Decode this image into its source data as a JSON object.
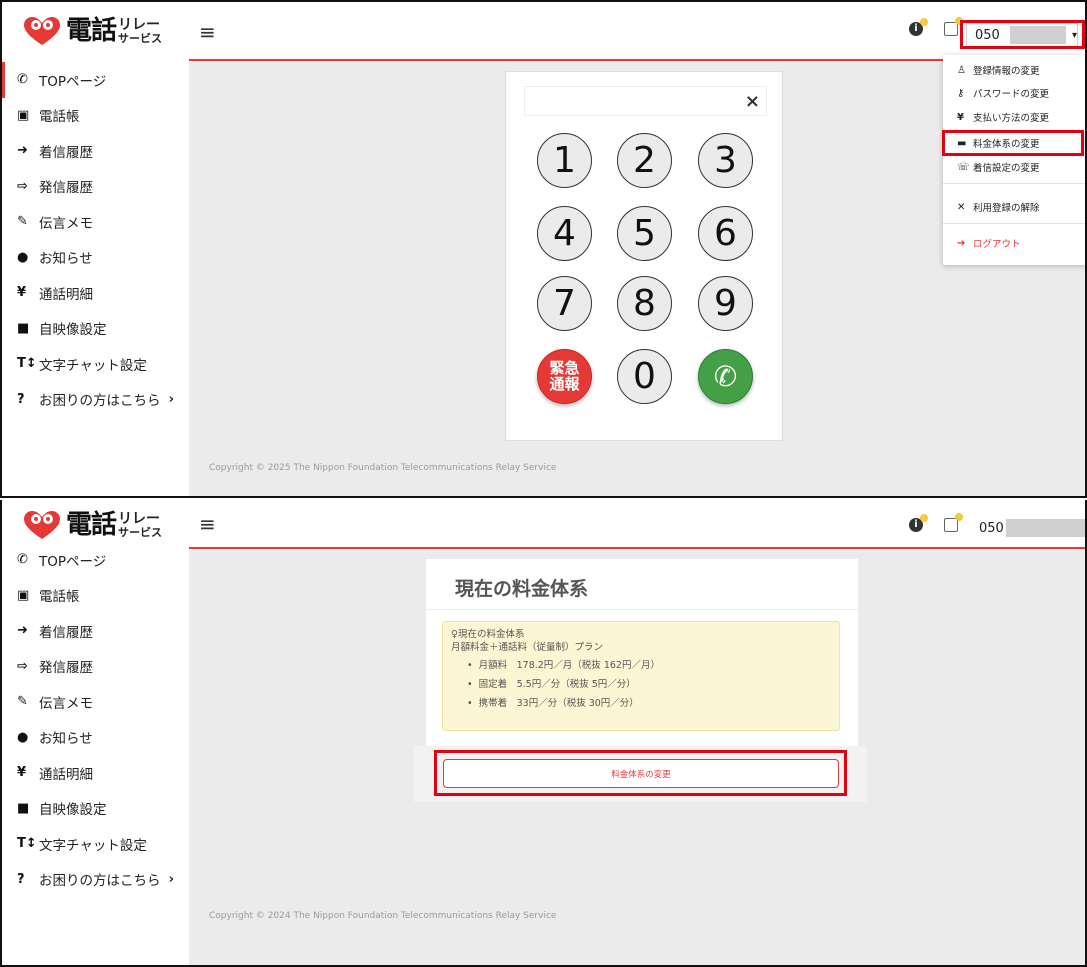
{
  "logo": {
    "main": "電話",
    "sub_a": "リレー",
    "sub_b": "サービス"
  },
  "nav": {
    "items": [
      {
        "icon": "phone-icon",
        "glyph": "✆",
        "label": "TOPページ"
      },
      {
        "icon": "phonebook-icon",
        "glyph": "▣",
        "label": "電話帳"
      },
      {
        "icon": "incoming-icon",
        "glyph": "➜",
        "label": "着信履歴"
      },
      {
        "icon": "outgoing-icon",
        "glyph": "⇨",
        "label": "発信履歴"
      },
      {
        "icon": "memo-edit-icon",
        "glyph": "✎",
        "label": "伝言メモ"
      },
      {
        "icon": "info-icon",
        "glyph": "●",
        "label": "お知らせ"
      },
      {
        "icon": "yen-icon",
        "glyph": "¥",
        "label": "通話明細"
      },
      {
        "icon": "video-icon",
        "glyph": "■",
        "label": "自映像設定"
      },
      {
        "icon": "text-size-icon",
        "glyph": "T↕",
        "label": "文字チャット設定"
      },
      {
        "icon": "help-icon",
        "glyph": "?",
        "label": "お困りの方はこちら",
        "chevron": "›"
      }
    ]
  },
  "topbar": {
    "hamburger": "≡",
    "phone_prefix": "050",
    "caret": "▾"
  },
  "dialpad": {
    "clear": "×",
    "keys": [
      "1",
      "2",
      "3",
      "4",
      "5",
      "6",
      "7",
      "8",
      "9"
    ],
    "emergency_label_1": "緊急",
    "emergency_label_2": "通報",
    "zero": "0",
    "call_glyph": "✆"
  },
  "dropdown": {
    "items": [
      {
        "icon": "user-icon",
        "glyph": "♙",
        "label": "登録情報の変更"
      },
      {
        "icon": "key-icon",
        "glyph": "⚷",
        "label": "パスワードの変更"
      },
      {
        "icon": "yen-icon",
        "glyph": "¥",
        "label": "支払い方法の変更"
      },
      {
        "icon": "wallet-icon",
        "glyph": "▬",
        "label": "料金体系の変更"
      },
      {
        "icon": "phone-settings-icon",
        "glyph": "☏",
        "label": "着信設定の変更"
      },
      {
        "icon": "unregister-icon",
        "glyph": "✕",
        "label": "利用登録の解除"
      },
      {
        "icon": "logout-icon",
        "glyph": "➔",
        "label": "ログアウト"
      }
    ]
  },
  "footer": {
    "copyright_top": "Copyright © 2025 The Nippon Foundation Telecommunications Relay Service",
    "copyright_bottom": "Copyright © 2024 The Nippon Foundation Telecommunications Relay Service"
  },
  "plan": {
    "title": "現在の料金体系",
    "box_heading": "♀現在の料金体系",
    "plan_name": "月額料金＋通話料（従量制）プラン",
    "details": [
      "月額料　178.2円／月（税抜 162円／月）",
      "固定着　5.5円／分（税抜 5円／分）",
      "携帯着　33円／分（税抜 30円／分）"
    ],
    "change_button": "料金体系の変更"
  },
  "colors": {
    "accent": "#e53935",
    "highlight": "#e3000f",
    "call": "#43a047",
    "notice_bg": "#fdf6d4"
  }
}
